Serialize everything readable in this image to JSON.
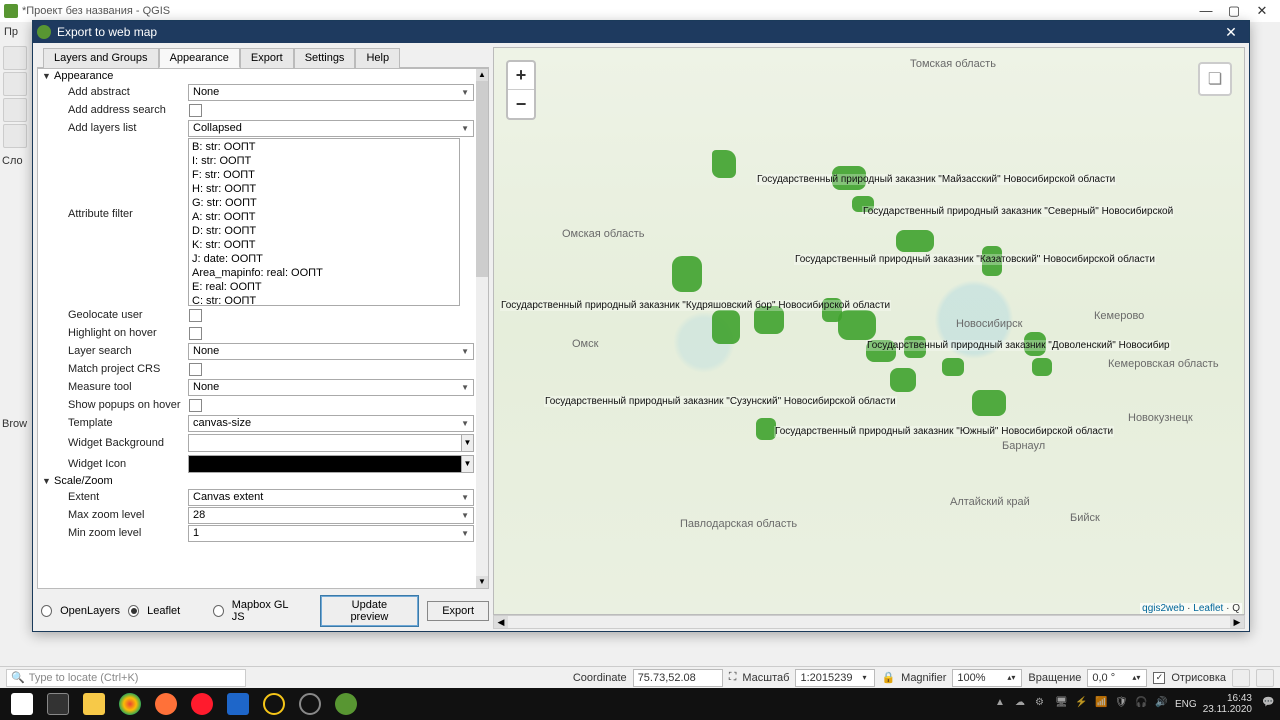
{
  "qgis": {
    "title": "*Проект без названия - QGIS",
    "menu_first": "Пр",
    "side1": "Сло",
    "side2": "Brow"
  },
  "dialog": {
    "title": "Export to web map",
    "tabs": [
      "Layers and Groups",
      "Appearance",
      "Export",
      "Settings",
      "Help"
    ],
    "active_tab": 1,
    "appearance": {
      "header": "Appearance",
      "add_abstract": {
        "label": "Add abstract",
        "value": "None"
      },
      "add_address": {
        "label": "Add address search"
      },
      "add_layers_list": {
        "label": "Add layers list",
        "value": "Collapsed"
      },
      "attribute_filter": {
        "label": "Attribute filter",
        "items": [
          "B: str: ООПТ",
          "I: str: ООПТ",
          "F: str: ООПТ",
          "H: str: ООПТ",
          "G: str: ООПТ",
          "A: str: ООПТ",
          "D: str: ООПТ",
          "K: str: ООПТ",
          "J: date: ООПТ",
          "Area_mapinfo: real: ООПТ",
          "E: real: ООПТ",
          "C: str: ООПТ"
        ]
      },
      "geolocate": {
        "label": "Geolocate user"
      },
      "highlight": {
        "label": "Highlight on hover"
      },
      "layer_search": {
        "label": "Layer search",
        "value": "None"
      },
      "match_crs": {
        "label": "Match project CRS"
      },
      "measure": {
        "label": "Measure tool",
        "value": "None"
      },
      "popups": {
        "label": "Show popups on hover"
      },
      "template": {
        "label": "Template",
        "value": "canvas-size"
      },
      "widget_bg": {
        "label": "Widget Background",
        "color": "#ffffff"
      },
      "widget_icon": {
        "label": "Widget Icon",
        "color": "#000000"
      }
    },
    "scale": {
      "header": "Scale/Zoom",
      "extent": {
        "label": "Extent",
        "value": "Canvas extent"
      },
      "max": {
        "label": "Max zoom level",
        "value": "28"
      },
      "min": {
        "label": "Min zoom level",
        "value": "1"
      }
    },
    "libs": {
      "openlayers": "OpenLayers",
      "leaflet": "Leaflet",
      "mapbox": "Mapbox GL JS"
    },
    "update": "Update preview",
    "export": "Export"
  },
  "map": {
    "cities": {
      "tomsk": "Томская область",
      "omsk_obl": "Омская область",
      "omsk": "Омск",
      "nsk": "Новосибирск",
      "kemerovo": "Кемерово",
      "kem_obl": "Кемеровская область",
      "novokuz": "Новокузнецк",
      "barnaul": "Барнаул",
      "biysk": "Бийск",
      "alt": "Алтайский край",
      "pavlodar": "Павлодарская область"
    },
    "features": [
      "Государственный природный заказник \"Майзасский\" Новосибирской области",
      "Государственный природный заказник \"Северный\" Новосибирской",
      "Государственный природный заказник \"Казатовский\" Новосибирской области",
      "Государственный природный заказник \"Кудряшовский бор\" Новосибирской области",
      "Государственный природный заказник \"Доволенский\" Новосибир",
      "Государственный природный заказник \"Сузунский\" Новосибирской области",
      "Государственный природный заказник \"Южный\" Новосибирской области"
    ],
    "attrib": {
      "a": "qgis2web",
      "sep": " · ",
      "b": "Leaflet",
      "c": " · Q"
    }
  },
  "status": {
    "locate": "Type to locate (Ctrl+K)",
    "coord_label": "Coordinate",
    "coord": "75.73,52.08",
    "scale_label": "Масштаб",
    "scale": "1:2015239",
    "mag_label": "Magnifier",
    "mag": "100%",
    "rot_label": "Вращение",
    "rot": "0,0 °",
    "render": "Отрисовка"
  },
  "taskbar": {
    "lang": "ENG",
    "time": "16:43",
    "date": "23.11.2020"
  }
}
